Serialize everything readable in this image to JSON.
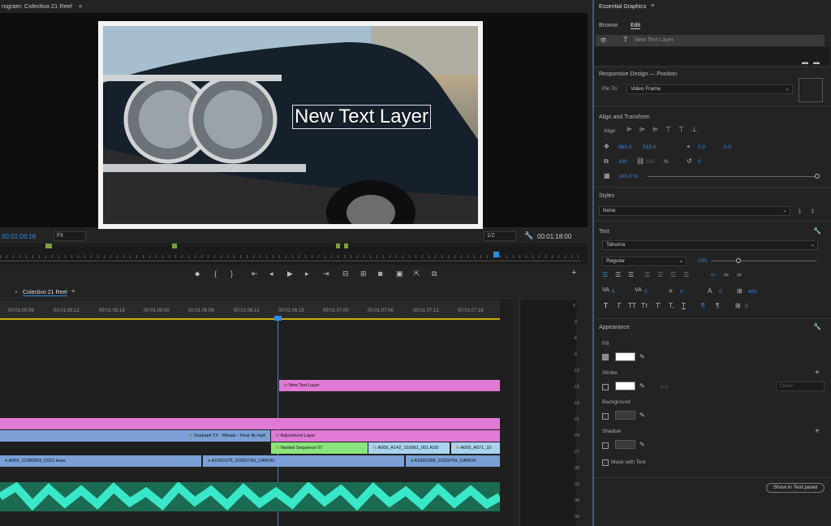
{
  "program": {
    "title": "rogram: Colectivo 21 Reel"
  },
  "monitor": {
    "text_layer": "New Text Layer",
    "timecode": "00:01:06:16",
    "fit": "Fit",
    "resolution": "1/2",
    "duration": "00:01:18:00"
  },
  "timeline": {
    "tab": "Colectivo 21 Reel",
    "ticks": [
      "00:01:05:06",
      "00:01:05:12",
      "00:01:05:18",
      "00:01:06:00",
      "00:01:06:06",
      "00:01:06:12",
      "00:01:06:18",
      "00:01:07:00",
      "00:01:07:06",
      "00:01:07:12",
      "00:01:07:18"
    ],
    "clips": {
      "text": "New Text Layer",
      "snake": "Snakepit TX - Rituals - Final 4k.mp4",
      "adjust": "Adjustment Layer",
      "nested": "Nested Sequence 07",
      "a005a": "A005_A142_102981_001.R3D",
      "a005b": "A005_A071_10",
      "a059": "A059_12080903_C022.braw",
      "a100a": "A100C075_2202072N_CANON",
      "a100b": "A100C098_220207IH_CANON"
    },
    "meter_scale": [
      "0",
      "-3",
      "-6",
      "-9",
      "-12",
      "-15",
      "-18",
      "-21",
      "-24",
      "-27",
      "-30",
      "-33",
      "-36",
      "-39"
    ]
  },
  "eg": {
    "title": "Essential Graphics",
    "tabs": [
      "Browse",
      "Edit"
    ],
    "layer": "New Text Layer",
    "responsive": "Responsive Design — Position",
    "pin_label": "Pin To:",
    "pin_value": "Video Frame",
    "align_transform": "Align and Transform",
    "align_label": "Align",
    "pos_x": "960.0",
    "pos_y": "519.0",
    "anchor_x": "0.0",
    "anchor_y": "0.0",
    "scale_w": "100",
    "scale_h": "100",
    "percent": "%",
    "rotation": "0",
    "opacity": "100.0 %",
    "styles": "Styles",
    "style_value": "None",
    "text": "Text",
    "font": "Tahoma",
    "weight": "Regular",
    "size": "100",
    "kern": "0",
    "track": "0",
    "lead": "0",
    "baseline": "0",
    "tsume": "400",
    "indent": "0",
    "appearance": "Appearance",
    "fill": "Fill",
    "stroke": "Stroke",
    "stroke_width": "4.0",
    "stroke_pos": "Outer",
    "background": "Background",
    "shadow": "Shadow",
    "mask": "Mask with Text",
    "show_in_text": "Show in Text panel",
    "ttbuttons": [
      "T",
      "T",
      "TT",
      "Tт",
      "T'",
      "T,",
      "T"
    ],
    "fill_color": "#ffffff",
    "stroke_color": "#ffffff",
    "bg_color": "#3a3a3a",
    "shadow_color": "#3a3a3a",
    "accent": "#2d8ceb"
  }
}
